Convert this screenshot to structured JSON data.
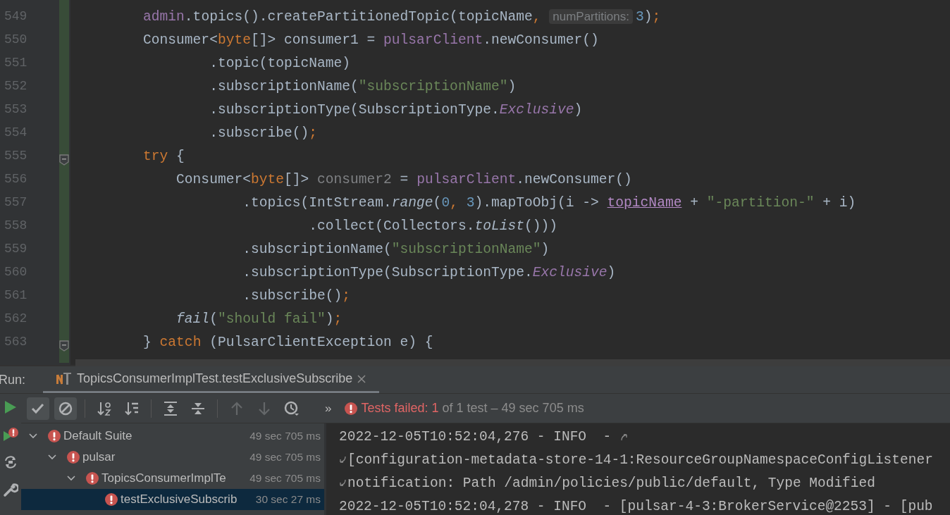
{
  "editor": {
    "lines": [
      {
        "number": "549",
        "fold": false,
        "tokens": [
          {
            "text": "        admin",
            "kind": "field"
          },
          {
            "text": ".topics().createPartitionedTopic(topicName",
            "kind": "plain"
          },
          {
            "text": ", ",
            "kind": "keyword"
          },
          {
            "text": "numPartitions:",
            "kind": "hint"
          },
          {
            "text": "3",
            "kind": "number"
          },
          {
            "text": ")",
            "kind": "plain"
          },
          {
            "text": ";",
            "kind": "keyword"
          }
        ]
      },
      {
        "number": "550",
        "fold": false,
        "tokens": [
          {
            "text": "        Consumer<",
            "kind": "plain"
          },
          {
            "text": "byte",
            "kind": "keyword"
          },
          {
            "text": "[]> consumer1 = ",
            "kind": "plain"
          },
          {
            "text": "pulsarClient",
            "kind": "field"
          },
          {
            "text": ".newConsumer()",
            "kind": "plain"
          }
        ]
      },
      {
        "number": "551",
        "fold": false,
        "tokens": [
          {
            "text": "                .topic(topicName)",
            "kind": "plain"
          }
        ]
      },
      {
        "number": "552",
        "fold": false,
        "tokens": [
          {
            "text": "                .subscriptionName(",
            "kind": "plain"
          },
          {
            "text": "\"subscriptionName\"",
            "kind": "string"
          },
          {
            "text": ")",
            "kind": "plain"
          }
        ]
      },
      {
        "number": "553",
        "fold": false,
        "tokens": [
          {
            "text": "                .subscriptionType(SubscriptionType.",
            "kind": "plain"
          },
          {
            "text": "Exclusive",
            "kind": "constant"
          },
          {
            "text": ")",
            "kind": "plain"
          }
        ]
      },
      {
        "number": "554",
        "fold": false,
        "tokens": [
          {
            "text": "                .subscribe()",
            "kind": "plain"
          },
          {
            "text": ";",
            "kind": "keyword"
          }
        ]
      },
      {
        "number": "555",
        "fold": true,
        "tokens": [
          {
            "text": "        try",
            "kind": "keyword"
          },
          {
            "text": " {",
            "kind": "plain"
          }
        ]
      },
      {
        "number": "556",
        "fold": false,
        "tokens": [
          {
            "text": "            Consumer<",
            "kind": "plain"
          },
          {
            "text": "byte",
            "kind": "keyword"
          },
          {
            "text": "[]> ",
            "kind": "plain"
          },
          {
            "text": "consumer2",
            "kind": "unused"
          },
          {
            "text": " = ",
            "kind": "plain"
          },
          {
            "text": "pulsarClient",
            "kind": "field"
          },
          {
            "text": ".newConsumer()",
            "kind": "plain"
          }
        ]
      },
      {
        "number": "557",
        "fold": false,
        "tokens": [
          {
            "text": "                    .topics(IntStream.",
            "kind": "plain"
          },
          {
            "text": "range",
            "kind": "static"
          },
          {
            "text": "(",
            "kind": "plain"
          },
          {
            "text": "0",
            "kind": "number"
          },
          {
            "text": ", ",
            "kind": "keyword"
          },
          {
            "text": "3",
            "kind": "number"
          },
          {
            "text": ").mapToObj(i -> ",
            "kind": "plain"
          },
          {
            "text": "topicName",
            "kind": "captured"
          },
          {
            "text": " + ",
            "kind": "plain"
          },
          {
            "text": "\"-partition-\"",
            "kind": "string"
          },
          {
            "text": " + i)",
            "kind": "plain"
          }
        ]
      },
      {
        "number": "558",
        "fold": false,
        "tokens": [
          {
            "text": "                            .collect(Collectors.",
            "kind": "plain"
          },
          {
            "text": "toList",
            "kind": "static"
          },
          {
            "text": "()))",
            "kind": "plain"
          }
        ]
      },
      {
        "number": "559",
        "fold": false,
        "tokens": [
          {
            "text": "                    .subscriptionName(",
            "kind": "plain"
          },
          {
            "text": "\"subscriptionName\"",
            "kind": "string"
          },
          {
            "text": ")",
            "kind": "plain"
          }
        ]
      },
      {
        "number": "560",
        "fold": false,
        "tokens": [
          {
            "text": "                    .subscriptionType(SubscriptionType.",
            "kind": "plain"
          },
          {
            "text": "Exclusive",
            "kind": "constant"
          },
          {
            "text": ")",
            "kind": "plain"
          }
        ]
      },
      {
        "number": "561",
        "fold": false,
        "tokens": [
          {
            "text": "                    .subscribe()",
            "kind": "plain"
          },
          {
            "text": ";",
            "kind": "keyword"
          }
        ]
      },
      {
        "number": "562",
        "fold": false,
        "tokens": [
          {
            "text": "            fail",
            "kind": "static"
          },
          {
            "text": "(",
            "kind": "plain"
          },
          {
            "text": "\"should fail\"",
            "kind": "string"
          },
          {
            "text": ")",
            "kind": "plain"
          },
          {
            "text": ";",
            "kind": "keyword"
          }
        ]
      },
      {
        "number": "563",
        "fold": true,
        "tokens": [
          {
            "text": "        } ",
            "kind": "plain"
          },
          {
            "text": "catch",
            "kind": "keyword"
          },
          {
            "text": " (PulsarClientException e) {",
            "kind": "plain"
          }
        ]
      }
    ]
  },
  "run_panel": {
    "label": "Run:",
    "tabs": [
      {
        "title": "TopicsConsumerImplTest.testExclusiveSubscribe",
        "selected": true
      }
    ],
    "side_buttons": [
      {
        "kind": "run"
      },
      {
        "kind": "rerun"
      },
      {
        "kind": "toggle"
      },
      {
        "kind": "settings"
      }
    ],
    "toolbar": [
      {
        "kind": "passed",
        "selected": true,
        "disabled": false
      },
      {
        "kind": "ignored",
        "selected": true,
        "disabled": false
      },
      {
        "kind": "divider"
      },
      {
        "kind": "alphabetical",
        "selected": false,
        "disabled": false
      },
      {
        "kind": "duration",
        "selected": false,
        "disabled": false
      },
      {
        "kind": "divider"
      },
      {
        "kind": "expand",
        "selected": false,
        "disabled": false
      },
      {
        "kind": "collapse",
        "selected": false,
        "disabled": false
      },
      {
        "kind": "divider"
      },
      {
        "kind": "previous",
        "selected": false,
        "disabled": true
      },
      {
        "kind": "next",
        "selected": false,
        "disabled": true
      },
      {
        "kind": "history",
        "selected": false,
        "disabled": false
      }
    ],
    "toolbar_overflow": "»",
    "status": {
      "failed": "Tests failed: 1",
      "summary": "of 1 test – 49 sec 705 ms"
    },
    "tree": [
      {
        "label": "Default Suite",
        "time": "49 sec 705 ms",
        "expanded": true,
        "selected": false,
        "children": [
          {
            "label": "pulsar",
            "time": "49 sec 705 ms",
            "expanded": true,
            "selected": false,
            "children": [
              {
                "label": "TopicsConsumerImplTe",
                "time": "49 sec 705 ms",
                "expanded": true,
                "selected": false,
                "children": [
                  {
                    "label": "testExclusiveSubscrib",
                    "time": "30 sec 27 ms",
                    "selected": true
                  }
                ]
              }
            ]
          }
        ]
      }
    ],
    "console": [
      {
        "text": "2022-12-05T10:52:04,276 - INFO  - ",
        "continued": false,
        "wraps": true
      },
      {
        "text": "[configuration-metadata-store-14-1:ResourceGroupNamespaceConfigListener",
        "continued": true,
        "wraps": false
      },
      {
        "text": "notification: Path /admin/policies/public/default, Type Modified",
        "continued": true,
        "wraps": false
      },
      {
        "text": "2022-12-05T10:52:04,278 - INFO  - [pulsar-4-3:BrokerService@2253] - [pub",
        "continued": false,
        "wraps": false
      }
    ]
  }
}
